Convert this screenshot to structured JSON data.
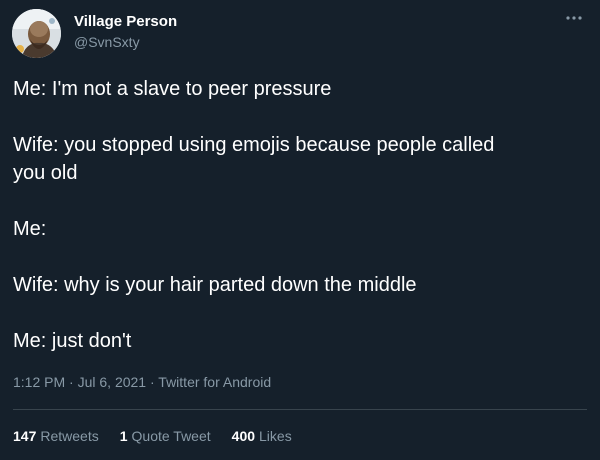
{
  "tweet": {
    "author": {
      "display_name": "Village Person",
      "handle": "@SvnSxty",
      "avatar_icon": "avatar-photo"
    },
    "more_icon": "more-horizontal-icon",
    "lines": [
      "Me: I'm not a slave to peer pressure",
      "Wife: you stopped using emojis because people called",
      "you old",
      "Me:",
      "Wife: why is your hair parted down the middle",
      "Me: just don't"
    ],
    "meta": {
      "time": "1:12 PM",
      "date": "Jul 6, 2021",
      "source": "Twitter for Android",
      "separator": "·"
    },
    "stats": {
      "retweets_count": "147",
      "retweets_label": "Retweets",
      "quote_count": "1",
      "quote_label": "Quote Tweet",
      "likes_count": "400",
      "likes_label": "Likes"
    }
  },
  "colors": {
    "background": "#15202b",
    "text_primary": "#ffffff",
    "text_secondary": "#8899a6",
    "divider": "#38444d"
  }
}
